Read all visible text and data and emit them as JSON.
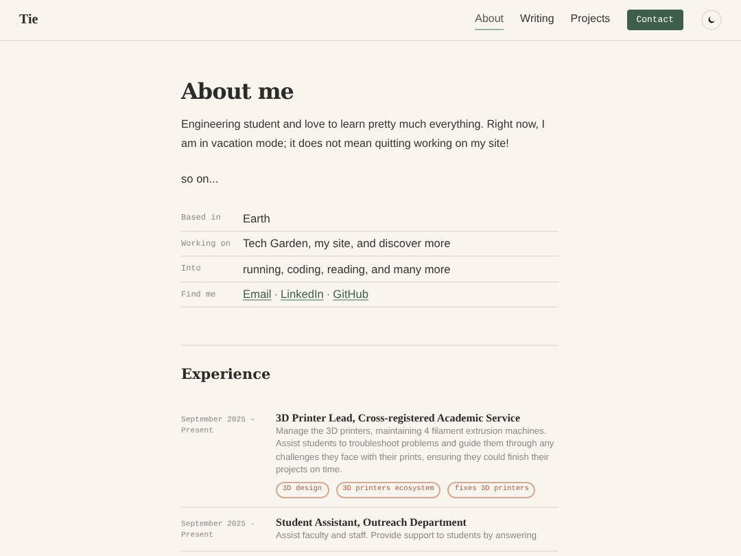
{
  "site": {
    "name": "Tie"
  },
  "nav": [
    {
      "label": "About",
      "selected": true
    },
    {
      "label": "Writing",
      "selected": false
    },
    {
      "label": "Projects",
      "selected": false
    }
  ],
  "contact_button": "Contact",
  "title": "About me",
  "intro": "Engineering student and love to learn pretty much everything. Right now, I am in vacation mode; it does not mean quitting working on my site!",
  "intro_more": "so on...",
  "facts": [
    {
      "label": "Based in",
      "kind": "text",
      "value": "Earth"
    },
    {
      "label": "Working on",
      "kind": "text",
      "value": "Tech Garden, my site, and discover more"
    },
    {
      "label": "Into",
      "kind": "text",
      "value": "running, coding, reading, and many more"
    },
    {
      "label": "Find me",
      "kind": "links",
      "links": [
        "Email",
        "LinkedIn",
        "GitHub"
      ],
      "separator": "·"
    }
  ],
  "experience": {
    "heading": "Experience",
    "items": [
      {
        "date_start": "September 2025 –",
        "date_end": "Present",
        "title": "3D Printer Lead, Cross-registered Academic Service",
        "description": "Manage the 3D printers, maintaining 4 filament extrusion machines. Assist students to troubleshoot problems and guide them through any challenges they face with their prints, ensuring they could finish their projects on time.",
        "tags": [
          "3D design",
          "3D printers ecosystem",
          "fixes 3D printers"
        ]
      },
      {
        "date_start": "September 2025 -",
        "date_end": "Present",
        "title": "Student Assistant, Outreach Department",
        "description": "Assist faculty and staff. Provide support to students by answering"
      }
    ]
  }
}
